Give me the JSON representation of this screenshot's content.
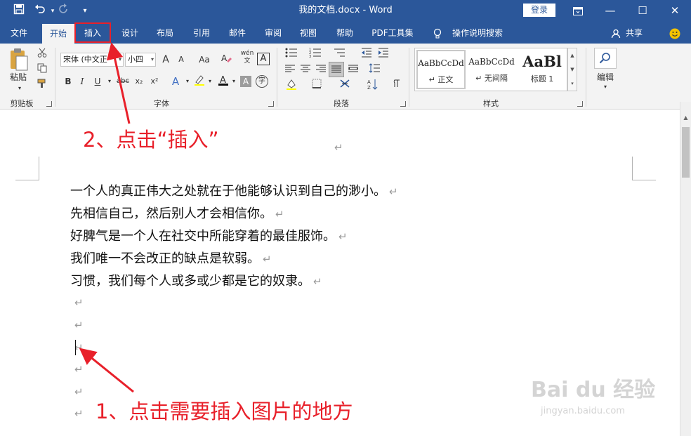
{
  "window": {
    "title": "我的文档.docx  -  Word",
    "login_label": "登录",
    "qat": {
      "save_icon": "save-icon",
      "undo_icon": "undo-icon",
      "redo_icon": "redo-icon",
      "customize_icon": "qat-customize-icon"
    },
    "buttons": {
      "restore_icon": "ribbon-display-icon",
      "minimize": "—",
      "maximize": "☐",
      "close": "✕"
    }
  },
  "tabs": [
    {
      "label": "文件"
    },
    {
      "label": "开始"
    },
    {
      "label": "插入"
    },
    {
      "label": "设计"
    },
    {
      "label": "布局"
    },
    {
      "label": "引用"
    },
    {
      "label": "邮件"
    },
    {
      "label": "审阅"
    },
    {
      "label": "视图"
    },
    {
      "label": "帮助"
    },
    {
      "label": "PDF工具集"
    },
    {
      "label": "操作说明搜索"
    },
    {
      "label": "共享"
    }
  ],
  "ribbon": {
    "clipboard": {
      "label": "剪贴板",
      "paste_label": "粘贴"
    },
    "font": {
      "label": "字体",
      "font_name": "宋体 (中文正",
      "font_size": "小四",
      "grow": "A",
      "shrink": "A",
      "change_case": "Aa",
      "bold": "B",
      "italic": "I",
      "underline": "U",
      "strike": "abc",
      "subscript": "x₂",
      "superscript": "x²"
    },
    "paragraph": {
      "label": "段落"
    },
    "styles": {
      "label": "样式",
      "items": [
        {
          "sample": "AaBbCcDd",
          "name": "↵ 正文"
        },
        {
          "sample": "AaBbCcDd",
          "name": "↵ 无间隔"
        },
        {
          "sample": "AaBl",
          "name": "标题 1"
        }
      ]
    },
    "editing": {
      "label": "编辑"
    }
  },
  "document": {
    "paragraph_mark": "↵",
    "lines": [
      "一个人的真正伟大之处就在于他能够认识到自己的渺小。",
      "先相信自己，然后别人才会相信你。",
      "好脾气是一个人在社交中所能穿着的最佳服饰。",
      "我们唯一不会改正的缺点是软弱。",
      "习惯，我们每个人或多或少都是它的奴隶。"
    ]
  },
  "annotations": {
    "step2": "2、点击“插入”",
    "step1": "1、点击需要插入图片的地方"
  },
  "watermark": {
    "brand": "Bai du 经验",
    "url": "jingyan.baidu.com"
  },
  "colors": {
    "word_blue": "#2b579a",
    "annotation_red": "#e8202a"
  }
}
